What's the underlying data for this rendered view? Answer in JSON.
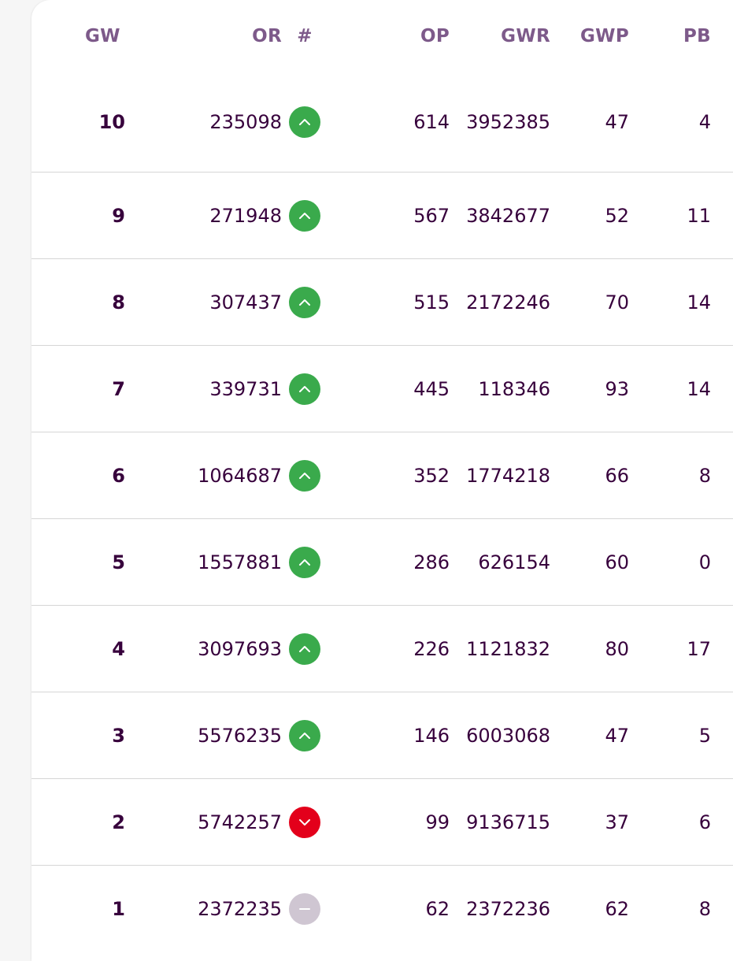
{
  "table": {
    "headers": {
      "gw": "GW",
      "or": "OR",
      "movement": "#",
      "op": "OP",
      "gwr": "GWR",
      "gwp": "GWP",
      "pb": "PB"
    },
    "colors": {
      "up": "#3aaa4c",
      "down": "#e3001b",
      "same": "#cfc6d2",
      "text": "#37003c",
      "header": "#7d5a8a"
    },
    "rows": [
      {
        "gw": "10",
        "or": "235098",
        "movement": "up",
        "op": "614",
        "gwr": "3952385",
        "gwp": "47",
        "pb": "4"
      },
      {
        "gw": "9",
        "or": "271948",
        "movement": "up",
        "op": "567",
        "gwr": "3842677",
        "gwp": "52",
        "pb": "11"
      },
      {
        "gw": "8",
        "or": "307437",
        "movement": "up",
        "op": "515",
        "gwr": "2172246",
        "gwp": "70",
        "pb": "14"
      },
      {
        "gw": "7",
        "or": "339731",
        "movement": "up",
        "op": "445",
        "gwr": "118346",
        "gwp": "93",
        "pb": "14"
      },
      {
        "gw": "6",
        "or": "1064687",
        "movement": "up",
        "op": "352",
        "gwr": "1774218",
        "gwp": "66",
        "pb": "8"
      },
      {
        "gw": "5",
        "or": "1557881",
        "movement": "up",
        "op": "286",
        "gwr": "626154",
        "gwp": "60",
        "pb": "0"
      },
      {
        "gw": "4",
        "or": "3097693",
        "movement": "up",
        "op": "226",
        "gwr": "1121832",
        "gwp": "80",
        "pb": "17"
      },
      {
        "gw": "3",
        "or": "5576235",
        "movement": "up",
        "op": "146",
        "gwr": "6003068",
        "gwp": "47",
        "pb": "5"
      },
      {
        "gw": "2",
        "or": "5742257",
        "movement": "down",
        "op": "99",
        "gwr": "9136715",
        "gwp": "37",
        "pb": "6"
      },
      {
        "gw": "1",
        "or": "2372235",
        "movement": "same",
        "op": "62",
        "gwr": "2372236",
        "gwp": "62",
        "pb": "8"
      }
    ]
  }
}
